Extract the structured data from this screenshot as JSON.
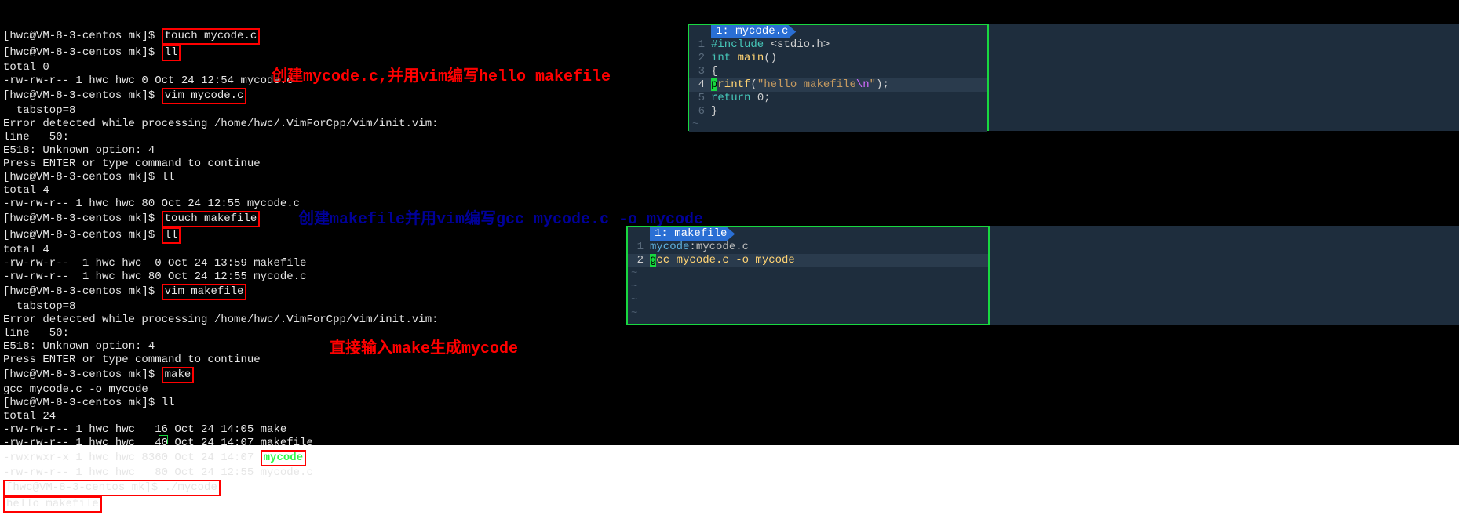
{
  "terminal": {
    "prompt": "[hwc@VM-8-3-centos mk]$ ",
    "lines": [
      {
        "type": "cmd",
        "text": "touch mycode.c",
        "boxed": true
      },
      {
        "type": "cmd",
        "text": "ll",
        "boxed": true
      },
      {
        "type": "out",
        "text": "total 0"
      },
      {
        "type": "out",
        "text": "-rw-rw-r-- 1 hwc hwc 0 Oct 24 12:54 mycode.c"
      },
      {
        "type": "cmd",
        "text": "vim mycode.c",
        "boxed": true
      },
      {
        "type": "out",
        "text": "  tabstop=8"
      },
      {
        "type": "out",
        "text": "Error detected while processing /home/hwc/.VimForCpp/vim/init.vim:"
      },
      {
        "type": "out",
        "text": "line   50:"
      },
      {
        "type": "out",
        "text": "E518: Unknown option: 4"
      },
      {
        "type": "out",
        "text": "Press ENTER or type command to continue"
      },
      {
        "type": "cmd",
        "text": "ll"
      },
      {
        "type": "out",
        "text": "total 4"
      },
      {
        "type": "out",
        "text": "-rw-rw-r-- 1 hwc hwc 80 Oct 24 12:55 mycode.c"
      },
      {
        "type": "cmd",
        "text": "touch makefile",
        "boxed": true
      },
      {
        "type": "cmd",
        "text": "ll",
        "boxed": true
      },
      {
        "type": "out",
        "text": "total 4"
      },
      {
        "type": "out",
        "text": "-rw-rw-r--  1 hwc hwc  0 Oct 24 13:59 makefile"
      },
      {
        "type": "out",
        "text": "-rw-rw-r--  1 hwc hwc 80 Oct 24 12:55 mycode.c"
      },
      {
        "type": "cmd",
        "text": "vim makefile",
        "boxed": true
      },
      {
        "type": "out",
        "text": "  tabstop=8"
      },
      {
        "type": "out",
        "text": "Error detected while processing /home/hwc/.VimForCpp/vim/init.vim:"
      },
      {
        "type": "out",
        "text": "line   50:"
      },
      {
        "type": "out",
        "text": "E518: Unknown option: 4"
      },
      {
        "type": "out",
        "text": "Press ENTER or type command to continue"
      },
      {
        "type": "cmd",
        "text": "make",
        "boxed": true
      },
      {
        "type": "out",
        "text": "gcc mycode.c -o mycode"
      },
      {
        "type": "cmd",
        "text": "ll"
      },
      {
        "type": "out",
        "text": "total 24"
      },
      {
        "type": "out",
        "text": "-rw-rw-r-- 1 hwc hwc   16 Oct 24 14:05 make"
      },
      {
        "type": "out",
        "text": "-rw-rw-r-- 1 hwc hwc   40 Oct 24 14:07 makefile"
      },
      {
        "type": "exec",
        "text": "-rwxrwxr-x 1 hwc hwc 8360 Oct 24 14:07 ",
        "exec": "mycode",
        "boxed": true
      },
      {
        "type": "out",
        "text": "-rw-rw-r-- 1 hwc hwc   80 Oct 24 12:55 mycode.c"
      },
      {
        "type": "cmd",
        "text": "./mycode",
        "promptboxed": true
      },
      {
        "type": "out",
        "text": "hello makefile",
        "boxed": true
      }
    ]
  },
  "annotations": {
    "a1": "创建mycode.c,并用vim编写hello makefile",
    "a2": "创建makefile并用vim编写gcc mycode.c -o mycode",
    "a3": "直接输入make生成mycode"
  },
  "editor1": {
    "tabnum": "1:",
    "tabname": "mycode.c",
    "lines": [
      {
        "n": "1",
        "parts": [
          {
            "c": "kw-include",
            "t": "#include"
          },
          {
            "c": "",
            "t": " "
          },
          {
            "c": "kw-angle",
            "t": "<stdio.h>"
          }
        ]
      },
      {
        "n": "2",
        "parts": [
          {
            "c": "kw-type",
            "t": "int"
          },
          {
            "c": "",
            "t": " "
          },
          {
            "c": "kw-func",
            "t": "main"
          },
          {
            "c": "kw-brace",
            "t": "()"
          }
        ]
      },
      {
        "n": "3",
        "parts": [
          {
            "c": "kw-brace",
            "t": "{"
          }
        ]
      },
      {
        "n": "4",
        "hl": true,
        "parts": [
          {
            "c": "",
            "t": "    "
          },
          {
            "c": "cursor-p",
            "t": "p"
          },
          {
            "c": "kw-func",
            "t": "rintf"
          },
          {
            "c": "kw-brace",
            "t": "("
          },
          {
            "c": "kw-str",
            "t": "\"hello makefile"
          },
          {
            "c": "kw-esc",
            "t": "\\n"
          },
          {
            "c": "kw-str",
            "t": "\""
          },
          {
            "c": "kw-brace",
            "t": ");"
          }
        ]
      },
      {
        "n": "5",
        "parts": [
          {
            "c": "",
            "t": "    "
          },
          {
            "c": "kw-return",
            "t": "return"
          },
          {
            "c": "",
            "t": " "
          },
          {
            "c": "kw-num",
            "t": "0"
          },
          {
            "c": "kw-brace",
            "t": ";"
          }
        ]
      },
      {
        "n": "6",
        "parts": [
          {
            "c": "kw-brace",
            "t": "}"
          }
        ]
      }
    ]
  },
  "editor2": {
    "tabnum": "1:",
    "tabname": "makefile",
    "lines": [
      {
        "n": "1",
        "parts": [
          {
            "c": "kw-target",
            "t": "mycode"
          },
          {
            "c": "kw-brace",
            "t": ":"
          },
          {
            "c": "",
            "t": "mycode.c"
          }
        ]
      },
      {
        "n": "2",
        "hl": true,
        "parts": [
          {
            "c": "",
            "t": "        "
          },
          {
            "c": "cursor-g",
            "t": "g"
          },
          {
            "c": "kw-func",
            "t": "cc mycode.c -o mycode"
          }
        ]
      }
    ]
  }
}
